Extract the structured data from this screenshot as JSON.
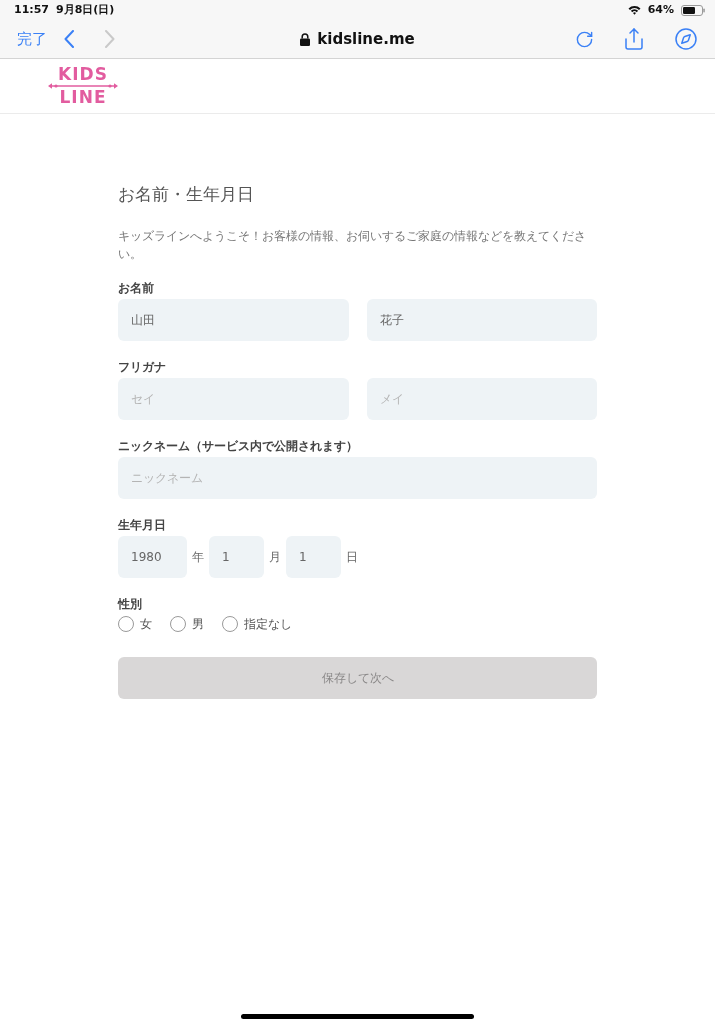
{
  "status_bar": {
    "time": "11:57",
    "date": "9月8日(日)",
    "battery": "64%"
  },
  "browser_toolbar": {
    "done": "完了",
    "nav": [
      {
        "kind": "back",
        "disabled": false
      },
      {
        "kind": "forward",
        "disabled": true
      }
    ],
    "url": "kidsline.me"
  },
  "site_header": {
    "logo": [
      "KIDS",
      "LINE"
    ]
  },
  "form": {
    "title": "お名前・生年月日",
    "intro": "キッズラインへようこそ！お客様の情報、お伺いするご家庭の情報などを教えてください。",
    "groups": [
      {
        "kind": "pair",
        "label": "お名前",
        "fields": [
          {
            "value": "山田"
          },
          {
            "value": "花子"
          }
        ]
      },
      {
        "kind": "pair",
        "label": "フリガナ",
        "fields": [
          {
            "placeholder": "セイ"
          },
          {
            "placeholder": "メイ"
          }
        ]
      },
      {
        "kind": "single",
        "label": "ニックネーム（サービス内で公開されます）",
        "fields": [
          {
            "placeholder": "ニックネーム"
          }
        ]
      },
      {
        "kind": "date",
        "label": "生年月日",
        "fields": [
          {
            "value": "1980",
            "unit": "年"
          },
          {
            "value": "1",
            "unit": "月"
          },
          {
            "value": "1",
            "unit": "日"
          }
        ]
      },
      {
        "kind": "radio",
        "label": "性別",
        "options": [
          {
            "label": "女",
            "selected": false
          },
          {
            "label": "男",
            "selected": false
          },
          {
            "label": "指定なし",
            "selected": false
          }
        ]
      }
    ],
    "submit": {
      "label": "保存して次へ",
      "disabled": true
    }
  }
}
